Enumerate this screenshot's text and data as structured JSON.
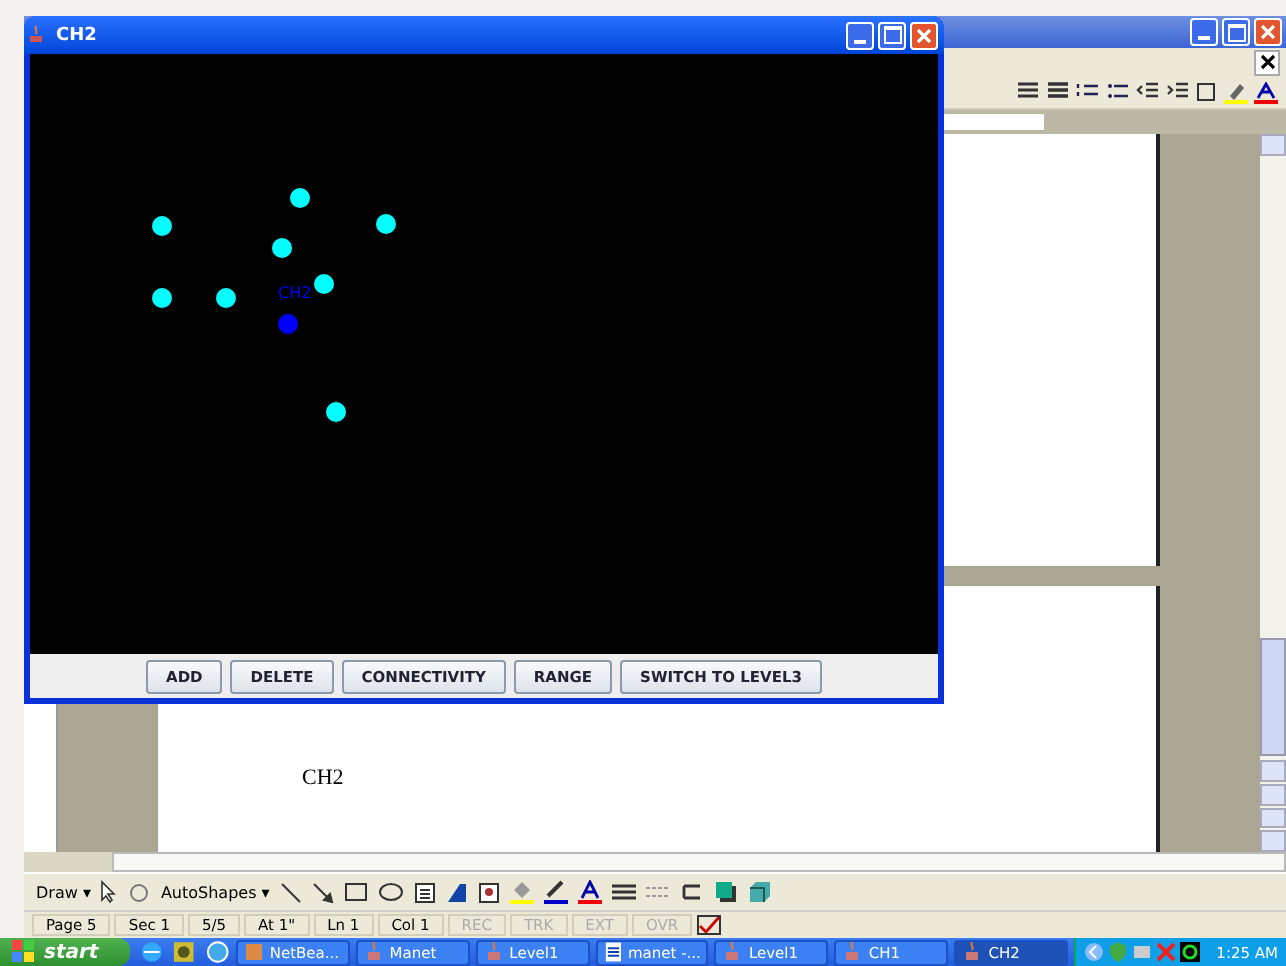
{
  "java_window": {
    "title": "CH2",
    "nodes": [
      {
        "color": "#00ffff"
      },
      {
        "color": "#00ffff"
      },
      {
        "color": "#00ffff"
      },
      {
        "color": "#00ffff"
      },
      {
        "color": "#00ffff"
      },
      {
        "color": "#00ffff"
      },
      {
        "color": "#00ffff"
      },
      {
        "color": "#00ffff"
      },
      {
        "color": "#0000ff",
        "label": "CH2"
      }
    ],
    "buttons": [
      "ADD",
      "DELETE",
      "CONNECTIVITY",
      "RANGE",
      "SWITCH TO LEVEL3"
    ]
  },
  "word_window": {
    "document_text": "CH2",
    "draw_toolbar": {
      "draw": "Draw ▾",
      "autoshapes": "AutoShapes ▾"
    },
    "status_bar": [
      {
        "text": "Page 5",
        "disabled": false
      },
      {
        "text": "Sec 1",
        "disabled": false
      },
      {
        "text": "5/5",
        "disabled": false
      },
      {
        "text": "At 1\"",
        "disabled": false
      },
      {
        "text": "Ln 1",
        "disabled": false
      },
      {
        "text": "Col 1",
        "disabled": false
      },
      {
        "text": "REC",
        "disabled": true
      },
      {
        "text": "TRK",
        "disabled": true
      },
      {
        "text": "EXT",
        "disabled": true
      },
      {
        "text": "OVR",
        "disabled": true
      }
    ]
  },
  "taskbar": {
    "start": "start",
    "items": [
      {
        "label": "NetBea...",
        "kind": "cube",
        "selected": false
      },
      {
        "label": "Manet",
        "kind": "java",
        "selected": false
      },
      {
        "label": "Level1",
        "kind": "java",
        "selected": false
      },
      {
        "label": "manet -...",
        "kind": "doc",
        "selected": false
      },
      {
        "label": "Level1",
        "kind": "java",
        "selected": false
      },
      {
        "label": "CH1",
        "kind": "java",
        "selected": false
      },
      {
        "label": "CH2",
        "kind": "java",
        "selected": true
      }
    ],
    "clock": "1:25 AM"
  }
}
